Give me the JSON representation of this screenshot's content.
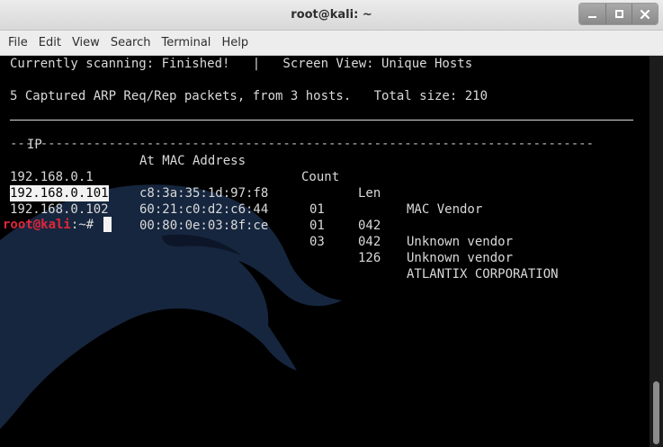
{
  "window": {
    "title": "root@kali: ~"
  },
  "menubar": {
    "items": [
      "File",
      "Edit",
      "View",
      "Search",
      "Terminal",
      "Help"
    ]
  },
  "terminal": {
    "status_line": "Currently scanning: Finished!   |   Screen View: Unique Hosts",
    "summary_line": "5 Captured ARP Req/Rep packets, from 3 hosts.   Total size: 210",
    "table": {
      "headers": [
        "IP",
        "At MAC Address",
        "Count",
        "Len",
        "MAC Vendor"
      ],
      "dashes": "-----------------------------------------------------------------------------",
      "rows": [
        {
          "ip": "192.168.0.1",
          "mac": "c8:3a:35:1d:97:f8",
          "count": "01",
          "len": "042",
          "vendor": "Unknown vendor"
        },
        {
          "ip": "192.168.0.101",
          "mac": "60:21:c0:d2:c6:44",
          "count": "01",
          "len": "042",
          "vendor": "Unknown vendor"
        },
        {
          "ip": "192.168.0.102",
          "mac": "00:80:0e:03:8f:ce",
          "count": "03",
          "len": "126",
          "vendor": "ATLANTIX CORPORATION"
        }
      ]
    },
    "prompt": {
      "user_host": "root@kali",
      "separator": ":",
      "cwd_symbol": "~# "
    }
  },
  "colors": {
    "terminal_bg": "#000000",
    "terminal_fg": "#d9d9d9",
    "prompt_user": "#e0263a",
    "wallpaper_dragon": "#16263f"
  },
  "icons": [
    "minimize-icon",
    "maximize-icon",
    "close-icon",
    "kali-dragon-watermark"
  ]
}
